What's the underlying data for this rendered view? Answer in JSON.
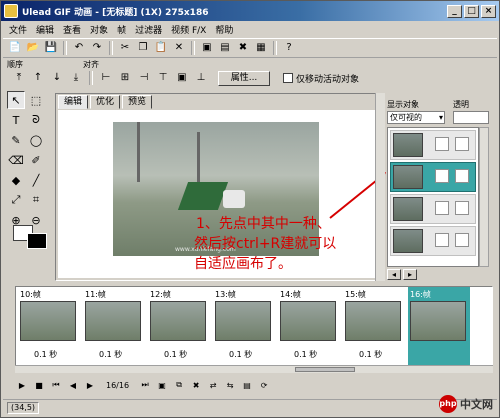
{
  "window": {
    "title": "Ulead GIF 动画 - [无标题] (1X) 275x186",
    "controls": {
      "minimize": "_",
      "maximize": "□",
      "close": "×"
    }
  },
  "menu": [
    "文件",
    "编辑",
    "查看",
    "对象",
    "帧",
    "过滤器",
    "视频 F/X",
    "帮助"
  ],
  "toolbar": {
    "icons": [
      "new-icon",
      "open-icon",
      "save-icon",
      "undo-icon",
      "redo-icon",
      "cut-icon",
      "copy-icon",
      "paste-icon",
      "delete-icon",
      "add-frame-icon",
      "frame-properties-icon",
      "delete-frame-icon",
      "image-properties-icon",
      "help-icon"
    ]
  },
  "toolbar2": {
    "order_label": "顺序",
    "align_label": "对齐",
    "attr_button": "属性...",
    "move_checkbox_label": "仅移动活动对象"
  },
  "editor": {
    "tabs": [
      "编辑",
      "优化",
      "预览"
    ],
    "active_tab": 0,
    "annotation_lines": [
      "1、先点中其中一种、",
      "然后按ctrl+R建就可以",
      "自适应画布了。"
    ],
    "watermark": "www.xunlefang.com"
  },
  "right_panel": {
    "show_objects_label": "显示对象",
    "opacity_label": "透明",
    "visible_select": "仅可视的"
  },
  "frames": [
    {
      "header": "10:帧",
      "delay": "0.1 秒"
    },
    {
      "header": "11:帧",
      "delay": "0.1 秒"
    },
    {
      "header": "12:帧",
      "delay": "0.1 秒"
    },
    {
      "header": "13:帧",
      "delay": "0.1 秒"
    },
    {
      "header": "14:帧",
      "delay": "0.1 秒"
    },
    {
      "header": "15:帧",
      "delay": "0.1 秒"
    },
    {
      "header": "16:帧",
      "delay": ""
    }
  ],
  "active_frame": 6,
  "playback": {
    "counter": "16/16"
  },
  "status": {
    "coords": "(34,5)"
  },
  "site_logo": {
    "mark": "php",
    "text": "中文网"
  },
  "colors": {
    "accent": "#3aa6a6",
    "title_bar": "#0a246a",
    "annotation": "#d60000"
  }
}
